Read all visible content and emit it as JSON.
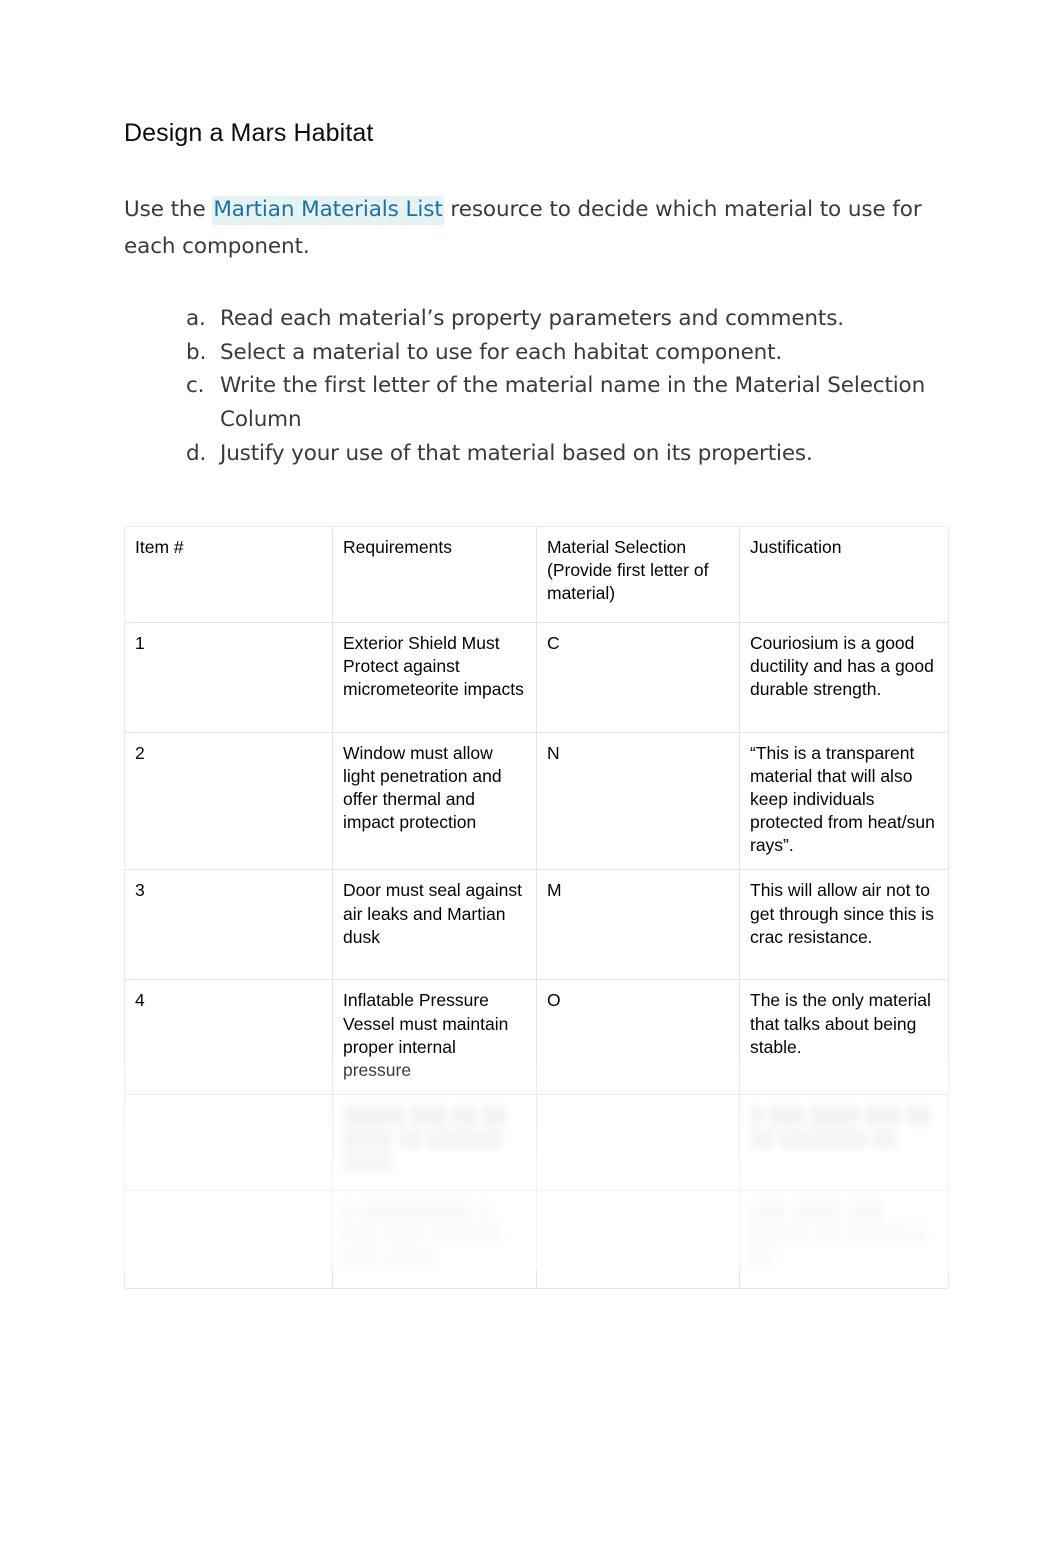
{
  "document": {
    "title": "Design a Mars Habitat",
    "intro": {
      "before_link": "Use the ",
      "link_text": "Martian Materials List",
      "after_link": " resource to decide which material to use for each component."
    },
    "steps": [
      {
        "marker": "a.",
        "text": "Read each material’s property parameters and comments."
      },
      {
        "marker": "b.",
        "text": "Select a material to use for each habitat component."
      },
      {
        "marker": "c.",
        "text": "Write the first letter of the material name in the Material Selection Column"
      },
      {
        "marker": "d.",
        "text": "Justify your use of that material based on its properties."
      }
    ]
  },
  "table": {
    "headers": {
      "item": "Item #",
      "requirements": "Requirements",
      "material_selection": "Material Selection (Provide first letter of material)",
      "justification": "Justification"
    },
    "rows": [
      {
        "item": "1",
        "requirements": "Exterior Shield Must Protect against micrometeorite impacts",
        "material_selection": "C",
        "justification": "Couriosium is a good ductility and has a good durable strength."
      },
      {
        "item": "2",
        "requirements": "Window must allow light penetration and offer thermal and impact protection",
        "material_selection": "N",
        "justification": "“This is a transparent material that will also keep individuals protected from heat/sun rays”."
      },
      {
        "item": "3",
        "requirements": "Door must seal against air leaks and Martian dusk",
        "material_selection": "M",
        "justification": "This will allow air not to get through since this is crac resistance."
      },
      {
        "item": "4",
        "requirements": "Inflatable Pressure Vessel must maintain proper internal pressure",
        "material_selection": "O",
        "justification": "The is the only material that talks about being stable."
      },
      {
        "item": "",
        "requirements": "░░░░░ ░░░ ░░ ░░ ░░░░ ░░ ░░░░░░ ░░░░",
        "material_selection": "",
        "justification": "░ ░░░ ░░░░ ░░░ ░░ ░░ ░░░░░░░ ░░",
        "blurred": true
      },
      {
        "item": "",
        "requirements": "░ ░░░░░░░░░ ░ ░░░ ░░░ ░░░░░░ ░░░ ░░░░",
        "material_selection": "",
        "justification": "░░░ ░░░░ ░░░ ░░░░░ ░░ ░░░░░ ░ ░░",
        "blurred": true
      }
    ]
  },
  "colors": {
    "link": "#1a73a8",
    "link_highlight": "#e6f3f2",
    "body_text": "#3a3a3a",
    "table_text": "#050505",
    "table_border": "#e4e4e4",
    "page_background": "#ffffff"
  }
}
